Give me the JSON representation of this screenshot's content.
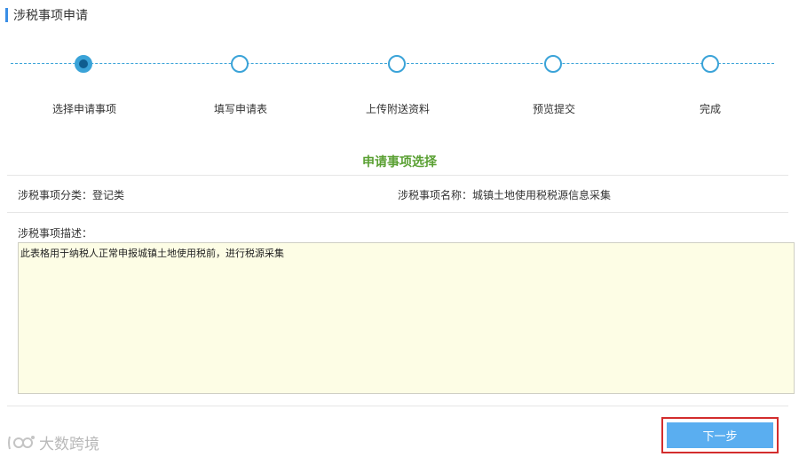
{
  "header": {
    "title": "涉税事项申请"
  },
  "steps": [
    {
      "label": "选择申请事项",
      "active": true
    },
    {
      "label": "填写申请表",
      "active": false
    },
    {
      "label": "上传附送资料",
      "active": false
    },
    {
      "label": "预览提交",
      "active": false
    },
    {
      "label": "完成",
      "active": false
    }
  ],
  "section": {
    "title": "申请事项选择"
  },
  "fields": {
    "category": "涉税事项分类：登记类",
    "name": "涉税事项名称：城镇土地使用税税源信息采集",
    "desc_label": "涉税事项描述：",
    "desc_value": "此表格用于纳税人正常申报城镇土地使用税前，进行税源采集"
  },
  "actions": {
    "next_label": "下一步"
  },
  "watermark": {
    "text": "大数跨境"
  },
  "colors": {
    "accent": "#3aa3d8",
    "section_green": "#5aa033",
    "button": "#5aaef0",
    "highlight_border": "#d32d2d"
  }
}
